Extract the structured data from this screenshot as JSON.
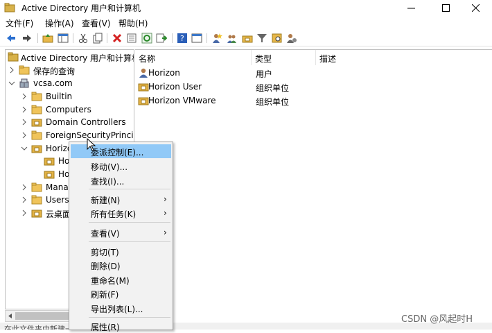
{
  "window": {
    "title": "Active Directory 用户和计算机"
  },
  "menu": [
    "文件(F)",
    "操作(A)",
    "查看(V)",
    "帮助(H)"
  ],
  "toolbar": {
    "icons": [
      "back-arrow-icon",
      "forward-arrow-icon",
      "up-folder-icon",
      "show-console-tree-icon",
      "cut-icon",
      "copy-icon",
      "delete-icon",
      "properties-icon",
      "refresh-icon",
      "export-list-icon",
      "help-icon",
      "console-icon",
      "new-user-icon",
      "new-group-icon",
      "new-ou-icon",
      "filter-icon",
      "find-icon",
      "add-to-group-icon"
    ]
  },
  "tree": {
    "root": "Active Directory 用户和计算机",
    "saved_queries": "保存的查询",
    "domain": "vcsa.com",
    "children": [
      "Builtin",
      "Computers",
      "Domain Controllers",
      "ForeignSecurityPrincipa",
      "Horizo",
      "Ho",
      "Ho",
      "Manag",
      "Users",
      "云桌面"
    ]
  },
  "list": {
    "columns": [
      "名称",
      "类型",
      "描述"
    ],
    "rows": [
      {
        "name": "Horizon",
        "type": "用户"
      },
      {
        "name": "Horizon User",
        "type": "组织单位"
      },
      {
        "name": "Horizon VMware",
        "type": "组织单位"
      }
    ]
  },
  "context_menu": {
    "items": [
      "委派控制(E)...",
      "移动(V)...",
      "查找(I)...",
      "新建(N)",
      "所有任务(K)",
      "查看(V)",
      "剪切(T)",
      "删除(D)",
      "重命名(M)",
      "刷新(F)",
      "导出列表(L)...",
      "属性(R)"
    ],
    "submenu_arrow": "›"
  },
  "status": {
    "text": "在此文件夹中新建一个"
  },
  "watermark": "CSDN @风起时H",
  "colors": {
    "highlight": "#91c9f7",
    "folder": "#e8b84a",
    "ou_folder": "#d9a93a"
  }
}
